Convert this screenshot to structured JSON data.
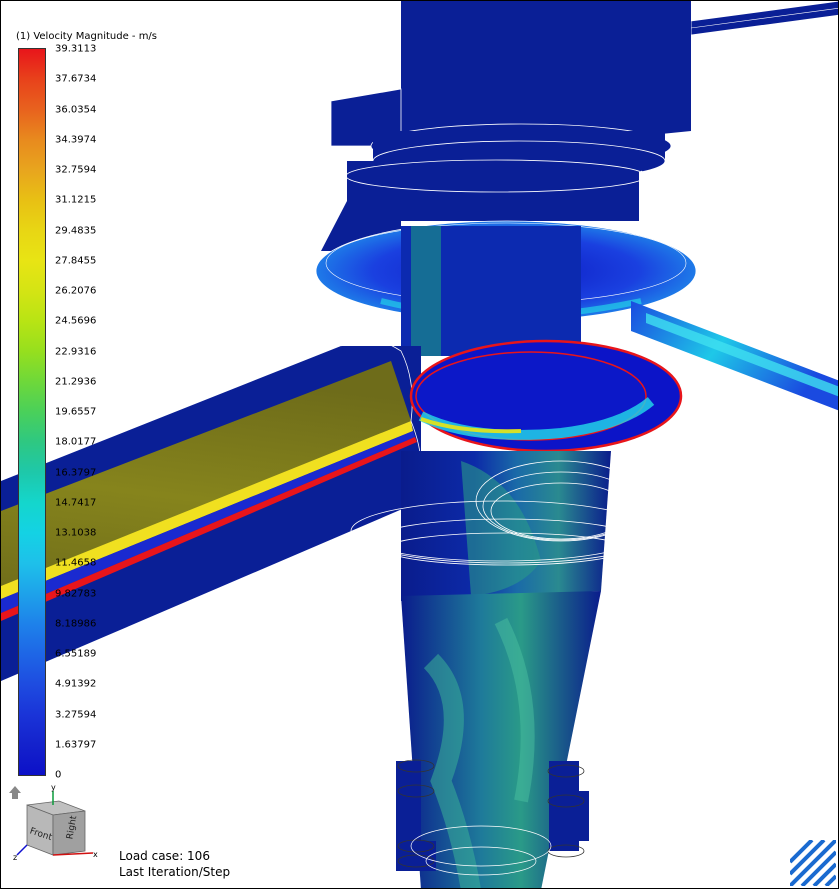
{
  "legend": {
    "title": "(1) Velocity Magnitude - m/s",
    "ticks": [
      "39.3113",
      "37.6734",
      "36.0354",
      "34.3974",
      "32.7594",
      "31.1215",
      "29.4835",
      "27.8455",
      "26.2076",
      "24.5696",
      "22.9316",
      "21.2936",
      "19.6557",
      "18.0177",
      "16.3797",
      "14.7417",
      "13.1038",
      "11.4658",
      "9.82783",
      "8.18986",
      "6.55189",
      "4.91392",
      "3.27594",
      "1.63797",
      "0"
    ],
    "colors": [
      "#e8151b",
      "#e8421b",
      "#e8621e",
      "#e88a1e",
      "#e8a51e",
      "#e8c014",
      "#e8d614",
      "#e8e414",
      "#d4e414",
      "#b8e414",
      "#96df1e",
      "#6ed83a",
      "#4ad05a",
      "#2ec882",
      "#1ec8aa",
      "#14d6cc",
      "#14d2e4",
      "#1ec0ea",
      "#1ea2ea",
      "#1e82ea",
      "#1e66e6",
      "#1e4ce0",
      "#1a34d8",
      "#1422cc",
      "#0c10c8"
    ]
  },
  "nav_cube": {
    "front": "Front",
    "right": "Right",
    "axis_y": "y",
    "axis_x": "x",
    "axis_z": "z"
  },
  "status": {
    "load_case": "Load case: 106",
    "iteration": "Last Iteration/Step"
  },
  "scene_colors": {
    "background": "#ffffff",
    "solid_blue": "#0a1f96",
    "inlet_flow": "#7c7a18",
    "high_velocity": "#e8151b",
    "mid_velocity": "#14d2e4"
  }
}
